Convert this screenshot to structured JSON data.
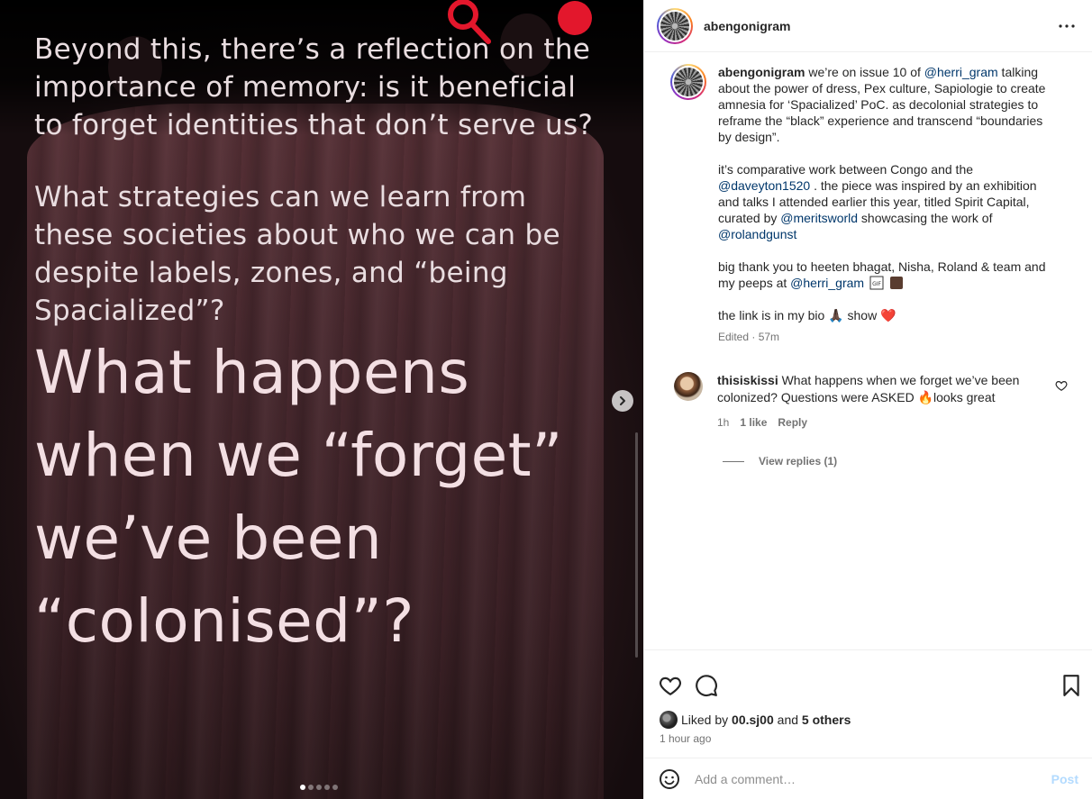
{
  "post_image": {
    "paragraph1": "Beyond this, there’s a reflection on the importance of memory: is it beneficial to forget identities that don’t serve us?",
    "paragraph2": "What strategies can we learn from these societies about who we can be despite labels, zones, and “being Spacialized”?",
    "headline_line1": "What happens",
    "headline_line2": "when we “forget”",
    "headline_line3": "we’ve been",
    "headline_line4": "“colonised”?",
    "carousel_dots": 5,
    "active_dot": 0
  },
  "header": {
    "username": "abengonigram"
  },
  "caption": {
    "username": "abengonigram",
    "p1_a": "we’re on issue 10 of ",
    "p1_mention": "@herri_gram",
    "p1_b": " talking about the power of dress, Pex culture, Sapiologie to create amnesia for ‘Spacialized’ PoC. as decolonial strategies to reframe the “black” experience and transcend “boundaries by design”.",
    "p2_a": "it’s comparative work between Congo and the ",
    "p2_mention1": "@daveyton1520",
    "p2_b": " . the piece was inspired by an exhibition and talks I attended earlier this year, titled Spirit Capital, curated by ",
    "p2_mention2": "@meritsworld",
    "p2_c": " showcasing the work of ",
    "p2_mention3": "@rolandgunst",
    "p3_a": "big thank you to heeten bhagat, Nisha, Roland & team and my peeps at ",
    "p3_mention": "@herri_gram",
    "p4_a": "the link is in my bio ",
    "p4_emoji1": "🙏🏿",
    "p4_b": " show ",
    "p4_emoji2": "❤️",
    "meta": "Edited · 57m"
  },
  "comment": {
    "username": "thisiskissi",
    "text_a": "What happens when we forget we’ve been colonized? Questions were ASKED ",
    "emoji": "🔥",
    "text_b": "looks great",
    "time": "1h",
    "likes": "1 like",
    "reply_label": "Reply",
    "view_replies": "View replies (1)"
  },
  "likes": {
    "prefix": "Liked by ",
    "user": "00.sj00",
    "and": " and ",
    "others": "5 others"
  },
  "time_ago": "1 hour ago",
  "comment_input": {
    "placeholder": "Add a comment…",
    "post_label": "Post"
  },
  "colors": {
    "accent_red": "#e3172c",
    "mention_blue": "#00376b",
    "post_disabled": "#b3dbff"
  },
  "icons": [
    "search-icon",
    "record-dot-icon",
    "chevron-right-icon",
    "more-icon",
    "heart-icon",
    "comment-icon",
    "bookmark-icon",
    "smile-icon"
  ]
}
